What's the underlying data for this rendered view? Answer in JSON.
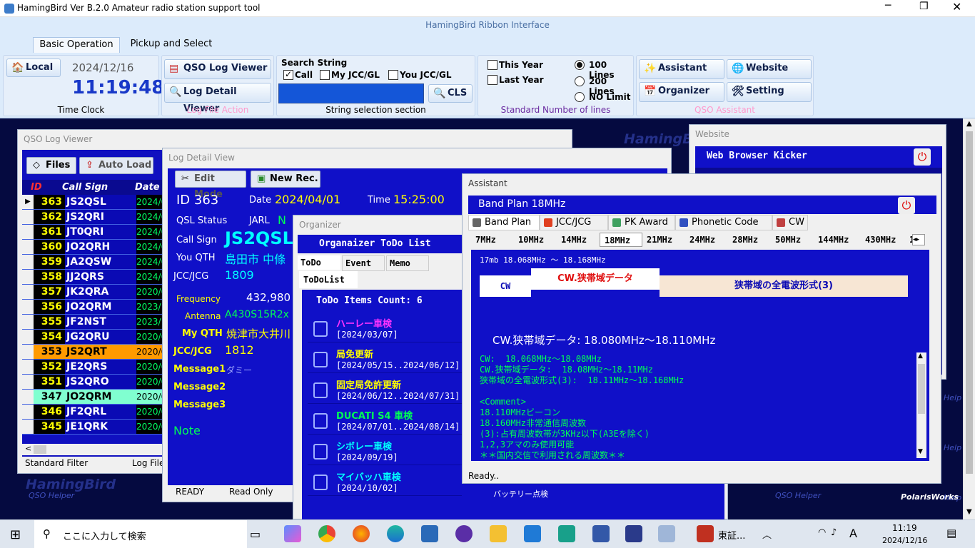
{
  "app": {
    "title": "HamingBird Ver B.2.0  Amateur radio station support tool",
    "ribbon_title": "HamingBird Ribbon Interface"
  },
  "tabs": [
    "Basic Operation",
    "Pickup and Select"
  ],
  "timeclock": {
    "local_btn": "Local",
    "date": "2024/12/16",
    "time": "11:19:48",
    "label": "Time Clock"
  },
  "logfile": {
    "qso_btn": "QSO Log Viewer",
    "detail_btn": "Log Detail Viewer",
    "label": "Log File Action"
  },
  "search": {
    "title": "Search String",
    "call": "Call",
    "myjcc": "My JCC/GL",
    "youjcc": "You JCC/GL",
    "cls": "CLS",
    "label": "String selection section"
  },
  "lines": {
    "this_year": "This Year",
    "last_year": "Last Year",
    "l100": "100 Lines",
    "l200": "200 Lines",
    "nolimit": "NO Limit",
    "label": "Standard Number of lines"
  },
  "assistant_grp": {
    "assistant": "Assistant",
    "website": "Website",
    "organizer": "Organizer",
    "setting": "Setting",
    "label": "QSO Assistant"
  },
  "qso": {
    "title": "QSO Log Viewer",
    "files": "Files",
    "auto": "Auto Load",
    "h_id": "ID",
    "h_call": "Call Sign",
    "h_date": "Date",
    "std_filter": "Standard Filter",
    "log_file": "Log File",
    "rows": [
      {
        "id": "363",
        "call": "JS2QSL",
        "date": "2024/0"
      },
      {
        "id": "362",
        "call": "JS2QRI",
        "date": "2024/0"
      },
      {
        "id": "361",
        "call": "JT0QRI",
        "date": "2024/0"
      },
      {
        "id": "360",
        "call": "JO2QRH",
        "date": "2024/0"
      },
      {
        "id": "359",
        "call": "JA2QSW",
        "date": "2024/0"
      },
      {
        "id": "358",
        "call": "JJ2QRS",
        "date": "2024/0"
      },
      {
        "id": "357",
        "call": "JK2QRA",
        "date": "2020/0"
      },
      {
        "id": "356",
        "call": "JO2QRM",
        "date": "2023/1"
      },
      {
        "id": "355",
        "call": "JF2NST",
        "date": "2023/1"
      },
      {
        "id": "354",
        "call": "JG2QRU",
        "date": "2020/0"
      },
      {
        "id": "353",
        "call": "JS2QRT",
        "date": "2020/0"
      },
      {
        "id": "352",
        "call": "JE2QRS",
        "date": "2020/0"
      },
      {
        "id": "351",
        "call": "JS2QRO",
        "date": "2020/0"
      },
      {
        "id": "347",
        "call": "JO2QRM",
        "date": "2020/0"
      },
      {
        "id": "346",
        "call": "JF2QRL",
        "date": "2020/0"
      },
      {
        "id": "345",
        "call": "JE1QRK",
        "date": "2020/0"
      }
    ]
  },
  "detail": {
    "title": "Log Detail View",
    "edit": "Edit Mode",
    "newrec": "New Rec.",
    "id": "ID 363",
    "date_l": "Date",
    "date": "2024/04/01",
    "time_l": "Time",
    "time": "15:25:00",
    "qsl_l": "QSL Status",
    "jarl": "JARL",
    "jarl_v": "N",
    "call_l": "Call Sign",
    "call": "JS2QSL",
    "youqth_l": "You QTH",
    "youqth": "島田市 中條",
    "jcc_l": "JCC/JCG",
    "jcc": "1809",
    "freq_l": "Frequency",
    "freq": "432,980",
    "ant_l": "Antenna",
    "ant": "A430S15R2x",
    "myqth_l": "My QTH",
    "myqth": "焼津市大井川",
    "jcc2_l": "JCC/JCG",
    "jcc2": "1812",
    "m1_l": "Message1",
    "m1": "ダミー",
    "m2_l": "Message2",
    "m3_l": "Message3",
    "note_l": "Note",
    "ready": "READY",
    "readonly": "Read Only"
  },
  "organizer": {
    "title": "Organizer",
    "head": "Organaizer ToDo List",
    "tab_todo": "ToDo",
    "tab_event": "Event",
    "tab_memo": "Memo",
    "subtab": "ToDoList",
    "count": "ToDo Items Count: 6",
    "items": [
      {
        "name": "ハーレー車検",
        "date": "[2024/03/07]",
        "color": "#ff33ff"
      },
      {
        "name": "局免更新",
        "date": "[2024/05/15..2024/06/12]",
        "color": "#ffff00"
      },
      {
        "name": "固定局免許更新",
        "date": "[2024/06/12..2024/07/31]",
        "color": "#ffff00"
      },
      {
        "name": "DUCATI S4 車検",
        "date": "[2024/07/01..2024/08/14]",
        "color": "#00ff55"
      },
      {
        "name": "シボレー車検",
        "date": "[2024/09/19]",
        "color": "#00ffff"
      },
      {
        "name": "マイバッハ車検",
        "date": "[2024/10/02]",
        "color": "#00ffff"
      }
    ],
    "note": "バッテリー点検"
  },
  "website": {
    "title": "Website",
    "head": "Web Browser Kicker"
  },
  "assistant": {
    "title": "Assistant",
    "head": "Band Plan 18MHz",
    "tabs": [
      "Band Plan",
      "JCC/JCG",
      "PK Award",
      "Phonetic Code",
      "CW"
    ],
    "bands": [
      "7MHz",
      "10MHz",
      "14MHz",
      "18MHz",
      "21MHz",
      "24MHz",
      "28MHz",
      "50MHz",
      "144MHz",
      "430MHz",
      "1"
    ],
    "range": "17mb 18.068MHz ～ 18.168MHz",
    "seg_cw": "CW",
    "seg_narrow": "CW.狭帯域データ",
    "seg_all": "狭帯域の全電波形式(3)",
    "selected": "CW.狭帯域データ: 18.080MHz～18.110MHz",
    "lines": [
      "CW:  18.068MHz～18.08MHz",
      "CW.狭帯域データ:  18.08MHz～18.11MHz",
      "狭帯域の全電波形式(3):  18.11MHz～18.168MHz",
      "",
      "<Comment>",
      "18.110MHzビーコン",
      "18.160MHz非常通信周波数",
      "(3):占有周波数帯が3KHz以下(A3Eを除く)",
      "1,2,3アマのみ使用可能",
      "＊＊国内交信で利用される周波数＊＊"
    ],
    "status": "Ready.."
  },
  "brand": {
    "hb": "HamingBird",
    "qso_helper": "QSO Helper",
    "help": "Help",
    "polaris": "PolarisWorks"
  },
  "taskbar": {
    "search": "ここに入力して検索",
    "app_label": "東証...",
    "time": "11:19",
    "date": "2024/12/16",
    "ime": "A"
  }
}
